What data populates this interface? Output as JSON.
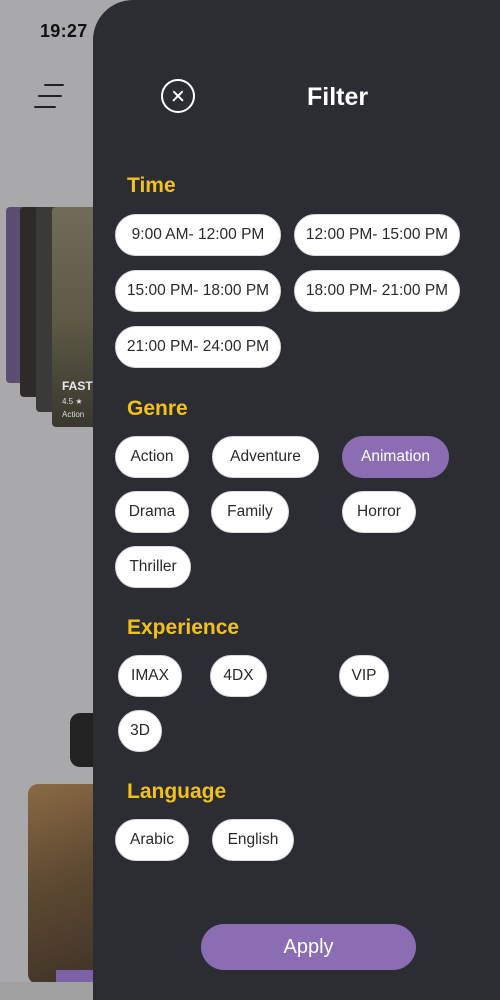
{
  "status_bar": {
    "time": "19:27"
  },
  "background": {
    "poster_title": "FAST",
    "poster_rating": "4.5 ★",
    "poster_genre": "Action"
  },
  "filter": {
    "title": "Filter",
    "close_icon": "close-circle-icon",
    "sections": {
      "time": {
        "title": "Time",
        "options": [
          "9:00 AM- 12:00 PM",
          "12:00 PM- 15:00 PM",
          "15:00 PM- 18:00 PM",
          "18:00 PM- 21:00 PM",
          "21:00 PM- 24:00 PM"
        ]
      },
      "genre": {
        "title": "Genre",
        "options": [
          "Action",
          "Adventure",
          "Animation",
          "Drama",
          "Family",
          "Horror",
          "Thriller"
        ],
        "selected": "Animation"
      },
      "experience": {
        "title": "Experience",
        "options": [
          "IMAX",
          "4DX",
          "VIP",
          "3D"
        ]
      },
      "language": {
        "title": "Language",
        "options": [
          "Arabic",
          "English"
        ]
      }
    },
    "apply_label": "Apply"
  },
  "colors": {
    "drawer_bg": "#2b2d33",
    "section_title": "#f2c11c",
    "accent": "#8b6db3",
    "chip_bg": "#ffffff"
  }
}
